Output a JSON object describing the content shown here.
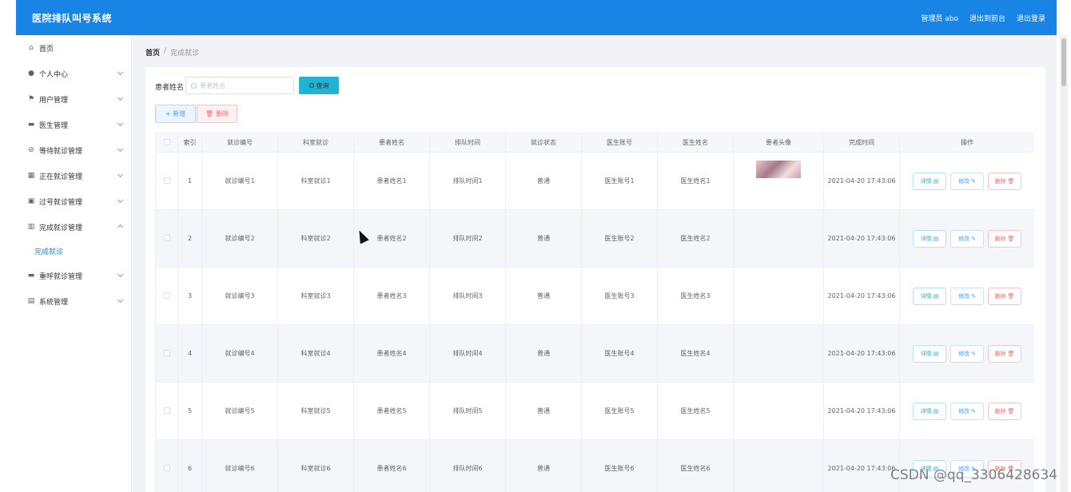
{
  "header": {
    "title": "医院排队叫号系统",
    "admin": "管理员 abo",
    "to_front": "退出到前台",
    "logout": "退出登录"
  },
  "sidebar": {
    "items": [
      {
        "label": "首页",
        "icon": "home-icon"
      },
      {
        "label": "个人中心",
        "icon": "user-icon"
      },
      {
        "label": "用户管理",
        "icon": "flag-icon"
      },
      {
        "label": "医生管理",
        "icon": "monitor-icon"
      },
      {
        "label": "等待就诊管理",
        "icon": "wait-icon"
      },
      {
        "label": "正在就诊管理",
        "icon": "grid-icon"
      },
      {
        "label": "过号就诊管理",
        "icon": "briefcase-icon"
      },
      {
        "label": "完成就诊管理",
        "icon": "bar-chart-icon"
      },
      {
        "label": "重呼就诊管理",
        "icon": "monitor-icon"
      },
      {
        "label": "系统管理",
        "icon": "clipboard-icon"
      }
    ],
    "sub_item": "完成就诊"
  },
  "breadcrumb": {
    "home": "首页",
    "sep": "/",
    "current": "完成就诊"
  },
  "search": {
    "label": "患者姓名",
    "placeholder": "患者姓名",
    "button": "查询"
  },
  "actions": {
    "add": "+ 新增",
    "delete": "删除"
  },
  "table": {
    "headers": [
      "索引",
      "就诊编号",
      "科室就诊",
      "患者姓名",
      "排队时间",
      "就诊状态",
      "医生账号",
      "医生姓名",
      "患者头像",
      "完成时间",
      "操作"
    ],
    "rows": [
      {
        "index": "1",
        "code": "就诊编号1",
        "dept": "科室就诊1",
        "patient": "患者姓名1",
        "queue": "排队时间1",
        "status": "普通",
        "doc_acc": "医生账号1",
        "doc_name": "医生姓名1",
        "done": "2021-04-20 17:43:06"
      },
      {
        "index": "2",
        "code": "就诊编号2",
        "dept": "科室就诊2",
        "patient": "患者姓名2",
        "queue": "排队时间2",
        "status": "普通",
        "doc_acc": "医生账号2",
        "doc_name": "医生姓名2",
        "done": "2021-04-20 17:43:06"
      },
      {
        "index": "3",
        "code": "就诊编号3",
        "dept": "科室就诊3",
        "patient": "患者姓名3",
        "queue": "排队时间3",
        "status": "普通",
        "doc_acc": "医生账号3",
        "doc_name": "医生姓名3",
        "done": "2021-04-20 17:43:06"
      },
      {
        "index": "4",
        "code": "就诊编号4",
        "dept": "科室就诊4",
        "patient": "患者姓名4",
        "queue": "排队时间4",
        "status": "普通",
        "doc_acc": "医生账号4",
        "doc_name": "医生姓名4",
        "done": "2021-04-20 17:43:06"
      },
      {
        "index": "5",
        "code": "就诊编号5",
        "dept": "科室就诊5",
        "patient": "患者姓名5",
        "queue": "排队时间5",
        "status": "普通",
        "doc_acc": "医生账号5",
        "doc_name": "医生姓名5",
        "done": "2021-04-20 17:43:06"
      },
      {
        "index": "6",
        "code": "就诊编号6",
        "dept": "科室就诊6",
        "patient": "患者姓名6",
        "queue": "排队时间6",
        "status": "普通",
        "doc_acc": "医生账号6",
        "doc_name": "医生姓名6",
        "done": "2021-04-20 17:43:06"
      }
    ],
    "op_detail": "详情",
    "op_edit": "修改",
    "op_delete": "删除"
  },
  "watermark": "CSDN @qq_3306428634"
}
